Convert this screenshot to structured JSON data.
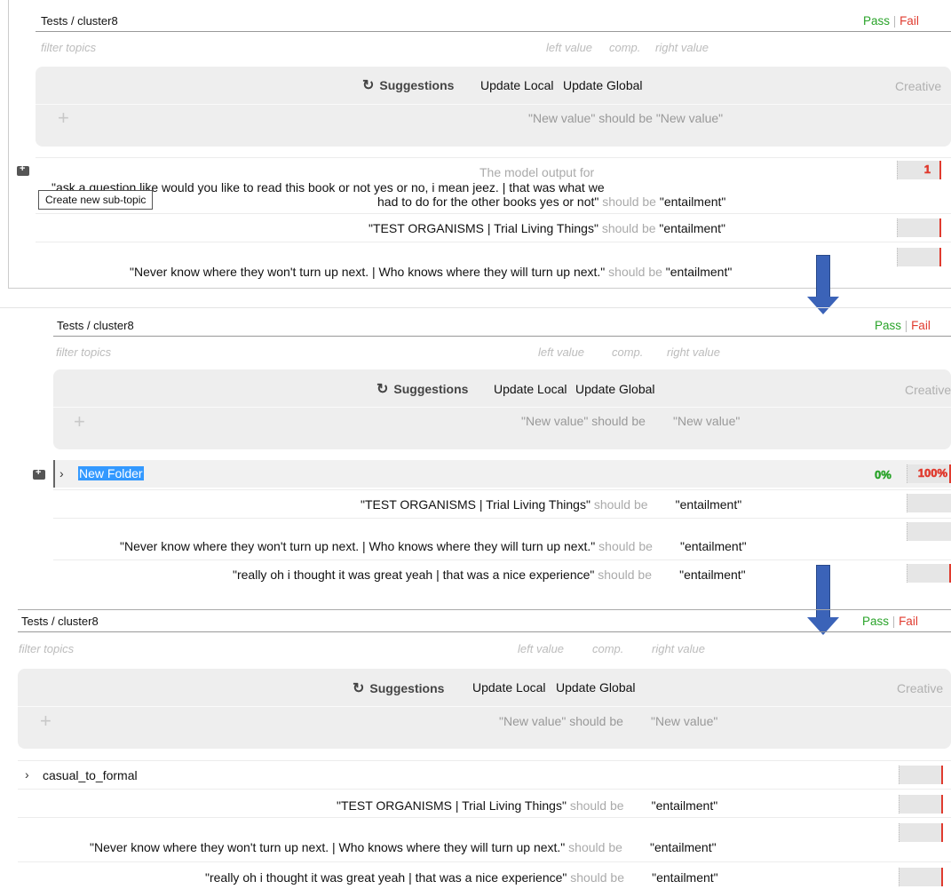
{
  "breadcrumb": "Tests / cluster8",
  "pass_label": "Pass",
  "fail_label": "Fail",
  "filter_placeholder": "filter topics",
  "col_left": "left value",
  "col_comp": "comp.",
  "col_right": "right value",
  "suggestions_label": "Suggestions",
  "update_local": "Update Local",
  "update_global": "Update Global",
  "creative_label": "Creative",
  "new_value_left": "\"New value\"",
  "should_be": "should be",
  "new_value_right": "\"New value\"",
  "tooltip": "Create new sub-topic",
  "p1_row1_prefix": "The model output for",
  "p1_row1_line1": "\"ask a question like would you like to read this book or not yes or no, i mean jeez. | that was what we",
  "p1_row1_line2": "had to do for the other books yes or not\"",
  "p1_row1_score": "1",
  "test_organisms": "\"TEST ORGANISMS | Trial Living Things\"",
  "never_know": "\"Never know where they won't turn up next. | Who knows where they will turn up next.\"",
  "really_oh": "\"really oh i thought it was great yeah | that was a nice experience\"",
  "entailment": "\"entailment\"",
  "new_folder": "New Folder",
  "pct_pass": "0%",
  "pct_fail": "100%",
  "casual_to_formal": "casual_to_formal",
  "colors": {
    "pass": "#29a329",
    "fail": "#e03b2f",
    "arrow": "#3b63b8",
    "selection": "#3399ff"
  }
}
